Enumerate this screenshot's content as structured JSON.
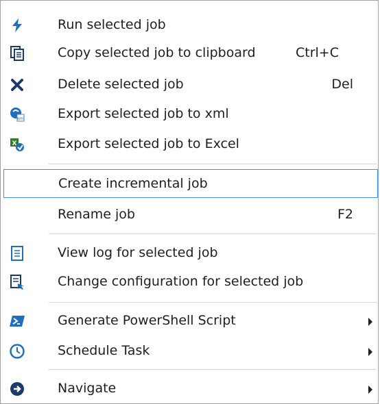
{
  "menu": {
    "items": [
      {
        "label": "Run selected job",
        "shortcut": "",
        "icon": "lightning-icon",
        "submenu": false
      },
      {
        "label": "Copy selected job to clipboard",
        "shortcut": "Ctrl+C",
        "icon": "copy-icon",
        "submenu": false
      },
      {
        "label": "Delete selected job",
        "shortcut": "Del",
        "icon": "delete-x-icon",
        "submenu": false
      },
      {
        "label": "Export selected job to xml",
        "shortcut": "",
        "icon": "export-xml-icon",
        "submenu": false
      },
      {
        "label": "Export selected job to Excel",
        "shortcut": "",
        "icon": "export-excel-icon",
        "submenu": false
      },
      {
        "label": "Create incremental job",
        "shortcut": "",
        "icon": "",
        "submenu": false,
        "highlighted": true
      },
      {
        "label": "Rename job",
        "shortcut": "F2",
        "icon": "",
        "submenu": false
      },
      {
        "label": "View log for selected job",
        "shortcut": "",
        "icon": "log-document-icon",
        "submenu": false
      },
      {
        "label": "Change configuration for selected job",
        "shortcut": "",
        "icon": "configuration-icon",
        "submenu": false
      },
      {
        "label": "Generate PowerShell Script",
        "shortcut": "",
        "icon": "powershell-icon",
        "submenu": true
      },
      {
        "label": "Schedule Task",
        "shortcut": "",
        "icon": "clock-icon",
        "submenu": true
      },
      {
        "label": "Navigate",
        "shortcut": "",
        "icon": "navigate-arrow-icon",
        "submenu": true
      }
    ]
  },
  "colors": {
    "highlight_border": "#3e92d8",
    "icon_blue": "#1e6fc0",
    "icon_dark": "#1a3a6b",
    "excel_green": "#2e7d32"
  }
}
